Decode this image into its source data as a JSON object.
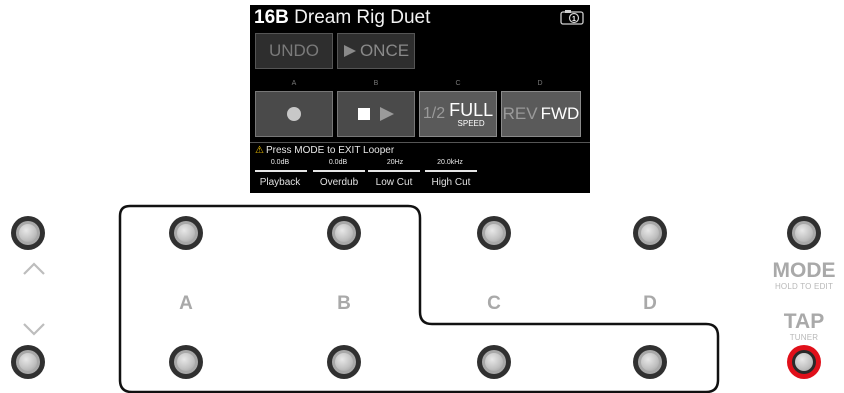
{
  "screen": {
    "preset_number": "16B",
    "preset_name": "Dream Rig Duet",
    "snapshot_icon": "camera-one-icon",
    "top_buttons": [
      {
        "label": "UNDO"
      },
      {
        "label": "ONCE",
        "icon": "play-icon"
      }
    ],
    "slot_labels": [
      "A",
      "B",
      "C",
      "D"
    ],
    "buttons": [
      {
        "icon": "record-icon"
      },
      {
        "icon": "stop-play-icon"
      },
      {
        "prefix": "1/2",
        "label": "FULL",
        "sub": "SPEED"
      },
      {
        "prefix": "REV",
        "label": "FWD"
      }
    ],
    "warning": "Press MODE to EXIT Looper",
    "params": [
      {
        "value": "0.0dB",
        "label": "Playback",
        "level": 1.0
      },
      {
        "value": "0.0dB",
        "label": "Overdub",
        "level": 1.0
      },
      {
        "value": "20Hz",
        "label": "Low Cut",
        "level": 0.0
      },
      {
        "value": "20.0kHz",
        "label": "High Cut",
        "level": 1.0
      }
    ]
  },
  "footswitch_labels": [
    "A",
    "B",
    "C",
    "D"
  ],
  "mode": {
    "label": "MODE",
    "sub": "HOLD TO EDIT"
  },
  "tap": {
    "label": "TAP",
    "sub": "TUNER"
  },
  "colors": {
    "tap_ring": "#e0101a",
    "warning": "#f5c400"
  }
}
